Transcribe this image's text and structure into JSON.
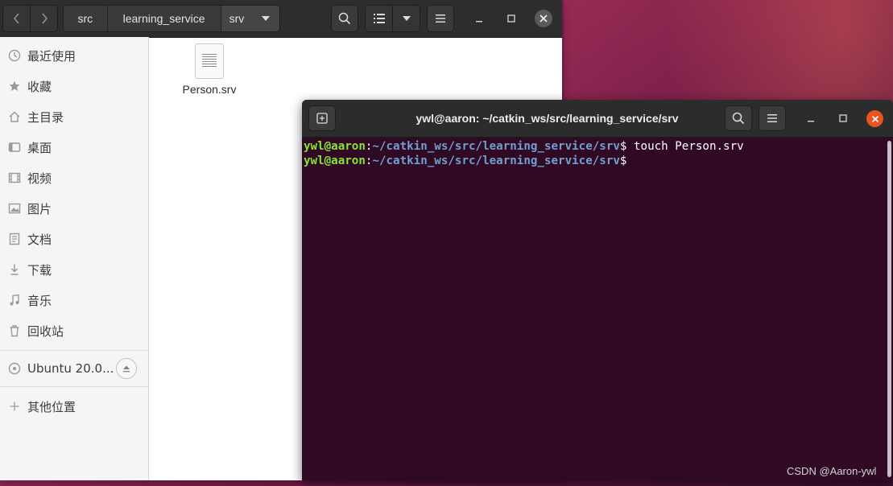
{
  "files": {
    "breadcrumbs": [
      "src",
      "learning_service",
      "srv"
    ],
    "sidebar": {
      "items": [
        {
          "label": "最近使用",
          "icon": "clock-icon"
        },
        {
          "label": "收藏",
          "icon": "star-icon"
        },
        {
          "label": "主目录",
          "icon": "home-icon"
        },
        {
          "label": "桌面",
          "icon": "desktop-icon"
        },
        {
          "label": "视频",
          "icon": "video-icon"
        },
        {
          "label": "图片",
          "icon": "image-icon"
        },
        {
          "label": "文档",
          "icon": "document-icon"
        },
        {
          "label": "下载",
          "icon": "download-icon"
        },
        {
          "label": "音乐",
          "icon": "music-icon"
        },
        {
          "label": "回收站",
          "icon": "trash-icon"
        }
      ],
      "device": {
        "label": "Ubuntu 20.0...",
        "icon": "disc-icon"
      },
      "other": {
        "label": "其他位置",
        "icon": "plus-icon"
      }
    },
    "content": {
      "files": [
        {
          "name": "Person.srv",
          "icon": "text-file-icon"
        }
      ]
    }
  },
  "terminal": {
    "title": "ywl@aaron: ~/catkin_ws/src/learning_service/srv",
    "lines": [
      {
        "user": "ywl@aaron",
        "sep": ":",
        "path": "~/catkin_ws/src/learning_service/srv",
        "prompt": "$",
        "command": " touch Person.srv"
      },
      {
        "user": "ywl@aaron",
        "sep": ":",
        "path": "~/catkin_ws/src/learning_service/srv",
        "prompt": "$",
        "command": ""
      }
    ],
    "colors": {
      "background": "#300a24",
      "user": "#8ae234",
      "path": "#729fcf",
      "close": "#e95420"
    }
  },
  "watermark": "CSDN @Aaron-ywl"
}
